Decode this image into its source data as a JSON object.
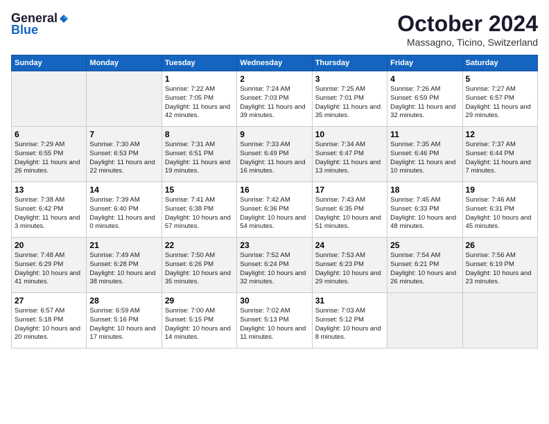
{
  "header": {
    "logo_general": "General",
    "logo_blue": "Blue",
    "month": "October 2024",
    "location": "Massagno, Ticino, Switzerland"
  },
  "days_of_week": [
    "Sunday",
    "Monday",
    "Tuesday",
    "Wednesday",
    "Thursday",
    "Friday",
    "Saturday"
  ],
  "weeks": [
    [
      {
        "day": "",
        "sunrise": "",
        "sunset": "",
        "daylight": ""
      },
      {
        "day": "",
        "sunrise": "",
        "sunset": "",
        "daylight": ""
      },
      {
        "day": "1",
        "sunrise": "Sunrise: 7:22 AM",
        "sunset": "Sunset: 7:05 PM",
        "daylight": "Daylight: 11 hours and 42 minutes."
      },
      {
        "day": "2",
        "sunrise": "Sunrise: 7:24 AM",
        "sunset": "Sunset: 7:03 PM",
        "daylight": "Daylight: 11 hours and 39 minutes."
      },
      {
        "day": "3",
        "sunrise": "Sunrise: 7:25 AM",
        "sunset": "Sunset: 7:01 PM",
        "daylight": "Daylight: 11 hours and 35 minutes."
      },
      {
        "day": "4",
        "sunrise": "Sunrise: 7:26 AM",
        "sunset": "Sunset: 6:59 PM",
        "daylight": "Daylight: 11 hours and 32 minutes."
      },
      {
        "day": "5",
        "sunrise": "Sunrise: 7:27 AM",
        "sunset": "Sunset: 6:57 PM",
        "daylight": "Daylight: 11 hours and 29 minutes."
      }
    ],
    [
      {
        "day": "6",
        "sunrise": "Sunrise: 7:29 AM",
        "sunset": "Sunset: 6:55 PM",
        "daylight": "Daylight: 11 hours and 26 minutes."
      },
      {
        "day": "7",
        "sunrise": "Sunrise: 7:30 AM",
        "sunset": "Sunset: 6:53 PM",
        "daylight": "Daylight: 11 hours and 22 minutes."
      },
      {
        "day": "8",
        "sunrise": "Sunrise: 7:31 AM",
        "sunset": "Sunset: 6:51 PM",
        "daylight": "Daylight: 11 hours and 19 minutes."
      },
      {
        "day": "9",
        "sunrise": "Sunrise: 7:33 AM",
        "sunset": "Sunset: 6:49 PM",
        "daylight": "Daylight: 11 hours and 16 minutes."
      },
      {
        "day": "10",
        "sunrise": "Sunrise: 7:34 AM",
        "sunset": "Sunset: 6:47 PM",
        "daylight": "Daylight: 11 hours and 13 minutes."
      },
      {
        "day": "11",
        "sunrise": "Sunrise: 7:35 AM",
        "sunset": "Sunset: 6:46 PM",
        "daylight": "Daylight: 11 hours and 10 minutes."
      },
      {
        "day": "12",
        "sunrise": "Sunrise: 7:37 AM",
        "sunset": "Sunset: 6:44 PM",
        "daylight": "Daylight: 11 hours and 7 minutes."
      }
    ],
    [
      {
        "day": "13",
        "sunrise": "Sunrise: 7:38 AM",
        "sunset": "Sunset: 6:42 PM",
        "daylight": "Daylight: 11 hours and 3 minutes."
      },
      {
        "day": "14",
        "sunrise": "Sunrise: 7:39 AM",
        "sunset": "Sunset: 6:40 PM",
        "daylight": "Daylight: 11 hours and 0 minutes."
      },
      {
        "day": "15",
        "sunrise": "Sunrise: 7:41 AM",
        "sunset": "Sunset: 6:38 PM",
        "daylight": "Daylight: 10 hours and 57 minutes."
      },
      {
        "day": "16",
        "sunrise": "Sunrise: 7:42 AM",
        "sunset": "Sunset: 6:36 PM",
        "daylight": "Daylight: 10 hours and 54 minutes."
      },
      {
        "day": "17",
        "sunrise": "Sunrise: 7:43 AM",
        "sunset": "Sunset: 6:35 PM",
        "daylight": "Daylight: 10 hours and 51 minutes."
      },
      {
        "day": "18",
        "sunrise": "Sunrise: 7:45 AM",
        "sunset": "Sunset: 6:33 PM",
        "daylight": "Daylight: 10 hours and 48 minutes."
      },
      {
        "day": "19",
        "sunrise": "Sunrise: 7:46 AM",
        "sunset": "Sunset: 6:31 PM",
        "daylight": "Daylight: 10 hours and 45 minutes."
      }
    ],
    [
      {
        "day": "20",
        "sunrise": "Sunrise: 7:48 AM",
        "sunset": "Sunset: 6:29 PM",
        "daylight": "Daylight: 10 hours and 41 minutes."
      },
      {
        "day": "21",
        "sunrise": "Sunrise: 7:49 AM",
        "sunset": "Sunset: 6:28 PM",
        "daylight": "Daylight: 10 hours and 38 minutes."
      },
      {
        "day": "22",
        "sunrise": "Sunrise: 7:50 AM",
        "sunset": "Sunset: 6:26 PM",
        "daylight": "Daylight: 10 hours and 35 minutes."
      },
      {
        "day": "23",
        "sunrise": "Sunrise: 7:52 AM",
        "sunset": "Sunset: 6:24 PM",
        "daylight": "Daylight: 10 hours and 32 minutes."
      },
      {
        "day": "24",
        "sunrise": "Sunrise: 7:53 AM",
        "sunset": "Sunset: 6:23 PM",
        "daylight": "Daylight: 10 hours and 29 minutes."
      },
      {
        "day": "25",
        "sunrise": "Sunrise: 7:54 AM",
        "sunset": "Sunset: 6:21 PM",
        "daylight": "Daylight: 10 hours and 26 minutes."
      },
      {
        "day": "26",
        "sunrise": "Sunrise: 7:56 AM",
        "sunset": "Sunset: 6:19 PM",
        "daylight": "Daylight: 10 hours and 23 minutes."
      }
    ],
    [
      {
        "day": "27",
        "sunrise": "Sunrise: 6:57 AM",
        "sunset": "Sunset: 5:18 PM",
        "daylight": "Daylight: 10 hours and 20 minutes."
      },
      {
        "day": "28",
        "sunrise": "Sunrise: 6:59 AM",
        "sunset": "Sunset: 5:16 PM",
        "daylight": "Daylight: 10 hours and 17 minutes."
      },
      {
        "day": "29",
        "sunrise": "Sunrise: 7:00 AM",
        "sunset": "Sunset: 5:15 PM",
        "daylight": "Daylight: 10 hours and 14 minutes."
      },
      {
        "day": "30",
        "sunrise": "Sunrise: 7:02 AM",
        "sunset": "Sunset: 5:13 PM",
        "daylight": "Daylight: 10 hours and 11 minutes."
      },
      {
        "day": "31",
        "sunrise": "Sunrise: 7:03 AM",
        "sunset": "Sunset: 5:12 PM",
        "daylight": "Daylight: 10 hours and 8 minutes."
      },
      {
        "day": "",
        "sunrise": "",
        "sunset": "",
        "daylight": ""
      },
      {
        "day": "",
        "sunrise": "",
        "sunset": "",
        "daylight": ""
      }
    ]
  ]
}
